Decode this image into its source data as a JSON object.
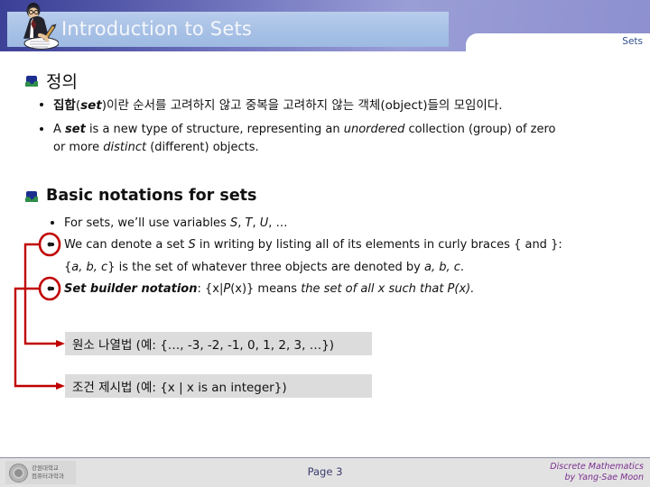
{
  "header": {
    "title": "Introduction to Sets",
    "topic_tab": "Sets",
    "clipart_icon": "person-writing-icon",
    "plate_color": "#a9c2e6",
    "band_color": "#4e52a4"
  },
  "sections": [
    {
      "icon": "section-bullet-icon",
      "heading": "정의",
      "bullets": [
        {
          "marker": "•",
          "text": "집합(set)이란 순서를 고려하지 않고 중복을 고려하지 않는 객체(object)들의 모임이다."
        },
        {
          "marker": "•",
          "text": "A set is a new type of structure, representing an unordered collection (group) of zero or more distinct (different) objects."
        }
      ]
    },
    {
      "icon": "section-bullet-icon",
      "heading": "Basic notations for sets",
      "bullets": [
        {
          "marker": "•",
          "text": "For sets, we’ll use variables S, T, U, …"
        },
        {
          "marker": "•",
          "text": "We can denote a set S in writing by listing all of its elements in curly braces { and }:"
        },
        {
          "marker": "",
          "text": "{a, b, c} is the set of whatever three objects are denoted by a, b, c."
        },
        {
          "marker": "•",
          "text": "Set builder notation: {x|P(x)} means the set of all x such that P(x)."
        }
      ]
    }
  ],
  "bullet_runs": {
    "ko_def": [
      {
        "t": "집합",
        "s": "b"
      },
      {
        "t": "(",
        "s": ""
      },
      {
        "t": "set",
        "s": "bi"
      },
      {
        "t": ")이란 순서를 고려하지 않고 중복을 고려하지 않는 객체(object)들의 모임이다.",
        "s": ""
      }
    ],
    "en_def_line1": [
      {
        "t": "A ",
        "s": ""
      },
      {
        "t": "set",
        "s": "bi"
      },
      {
        "t": " is a new type of structure, representing an ",
        "s": ""
      },
      {
        "t": "unordered",
        "s": "i"
      },
      {
        "t": " collection (group) of zero",
        "s": ""
      }
    ],
    "en_def_line2": [
      {
        "t": "or more ",
        "s": ""
      },
      {
        "t": "distinct",
        "s": "i"
      },
      {
        "t": " (different) objects.",
        "s": ""
      }
    ],
    "for_sets": [
      {
        "t": "For sets, we’ll use variables ",
        "s": ""
      },
      {
        "t": "S",
        "s": "i"
      },
      {
        "t": ", ",
        "s": ""
      },
      {
        "t": "T",
        "s": "i"
      },
      {
        "t": ", ",
        "s": ""
      },
      {
        "t": "U",
        "s": "i"
      },
      {
        "t": ", …",
        "s": ""
      }
    ],
    "denote_line1": [
      {
        "t": "We can denote a set ",
        "s": ""
      },
      {
        "t": "S",
        "s": "i"
      },
      {
        "t": " in writing by listing all of its elements in curly braces { and }:",
        "s": ""
      }
    ],
    "denote_line2": [
      {
        "t": "{",
        "s": ""
      },
      {
        "t": "a, b, c",
        "s": "i"
      },
      {
        "t": "} is the set of whatever three objects are denoted by ",
        "s": ""
      },
      {
        "t": "a, b, c",
        "s": "i"
      },
      {
        "t": ".",
        "s": ""
      }
    ],
    "set_builder": [
      {
        "t": "Set builder notation",
        "s": "bi"
      },
      {
        "t": ": {x|",
        "s": ""
      },
      {
        "t": "P",
        "s": "i"
      },
      {
        "t": "(x)} means ",
        "s": ""
      },
      {
        "t": "the set of all x such that P(x).",
        "s": "i"
      }
    ]
  },
  "callouts": [
    {
      "label": "원소 나열법 (예: {…, -3, -2, -1, 0, 1, 2, 3, …})"
    },
    {
      "label": "조건 제시법 (예: {x | x is an integer})"
    }
  ],
  "annotation": {
    "color": "#c00000",
    "ellipse_count": 2,
    "arrow_count": 2
  },
  "footer": {
    "page_label": "Page 3",
    "credit_line1": "Discrete Mathematics",
    "credit_line2": "by Yang-Sae Moon",
    "credit_color": "#7b2f8f",
    "logo_line1": "강원대학교",
    "logo_line2": "컴퓨터과학과"
  }
}
